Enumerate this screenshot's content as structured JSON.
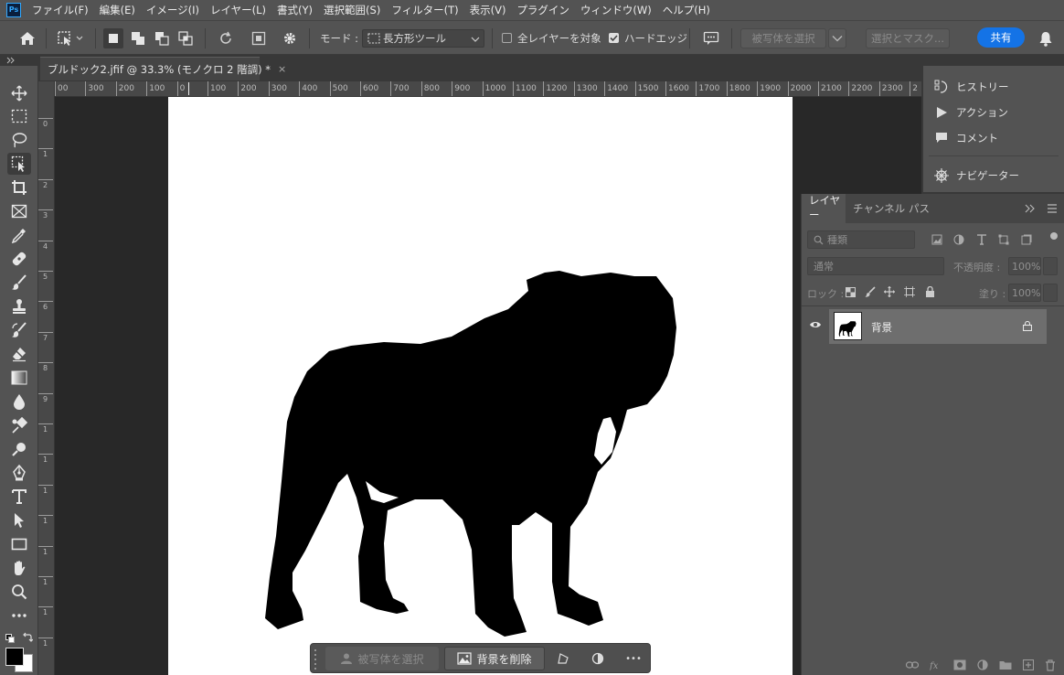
{
  "app": {
    "logo": "Ps"
  },
  "menu": [
    "ファイル(F)",
    "編集(E)",
    "イメージ(I)",
    "レイヤー(L)",
    "書式(Y)",
    "選択範囲(S)",
    "フィルター(T)",
    "表示(V)",
    "プラグイン",
    "ウィンドウ(W)",
    "ヘルプ(H)"
  ],
  "options": {
    "mode_label": "モード :",
    "mode_value": "長方形ツール",
    "all_layers": "全レイヤーを対象",
    "hard_edge": "ハードエッジ",
    "select_subject": "被写体を選択",
    "select_mask": "選択とマスク...",
    "share": "共有"
  },
  "document": {
    "tab_title": "ブルドック2.jfif @ 33.3% (モノクロ 2 階調) *",
    "close_glyph": "×"
  },
  "ruler": {
    "top_labels": [
      "00",
      "300",
      "200",
      "100",
      "0",
      "100",
      "200",
      "300",
      "400",
      "500",
      "600",
      "700",
      "800",
      "900",
      "1000",
      "1100",
      "1200",
      "1300",
      "1400",
      "1500",
      "1600",
      "1700",
      "1800",
      "1900",
      "2000",
      "2100",
      "2200",
      "2300",
      "2"
    ],
    "left_labels": [
      "0",
      "1",
      "2",
      "3",
      "4",
      "5",
      "6",
      "7",
      "8",
      "9",
      "1",
      "1",
      "1",
      "1",
      "1",
      "1",
      "1",
      "1"
    ]
  },
  "contextual_bar": {
    "select_subject": "被写体を選択",
    "remove_bg": "背景を削除",
    "more": "•••"
  },
  "mini_panels": [
    "ヒストリー",
    "アクション",
    "コメント",
    "ナビゲーター"
  ],
  "layers_panel": {
    "tabs": [
      "レイヤー",
      "チャンネル",
      "パス"
    ],
    "filter_kind": "種類",
    "blend_mode": "通常",
    "opacity_label": "不透明度 :",
    "opacity_value": "100%",
    "lock_label": "ロック :",
    "fill_label": "塗り :",
    "fill_value": "100%",
    "layer_name": "背景"
  },
  "colors": {
    "accent": "#1473e6",
    "panel": "#535353",
    "dark": "#282828"
  }
}
